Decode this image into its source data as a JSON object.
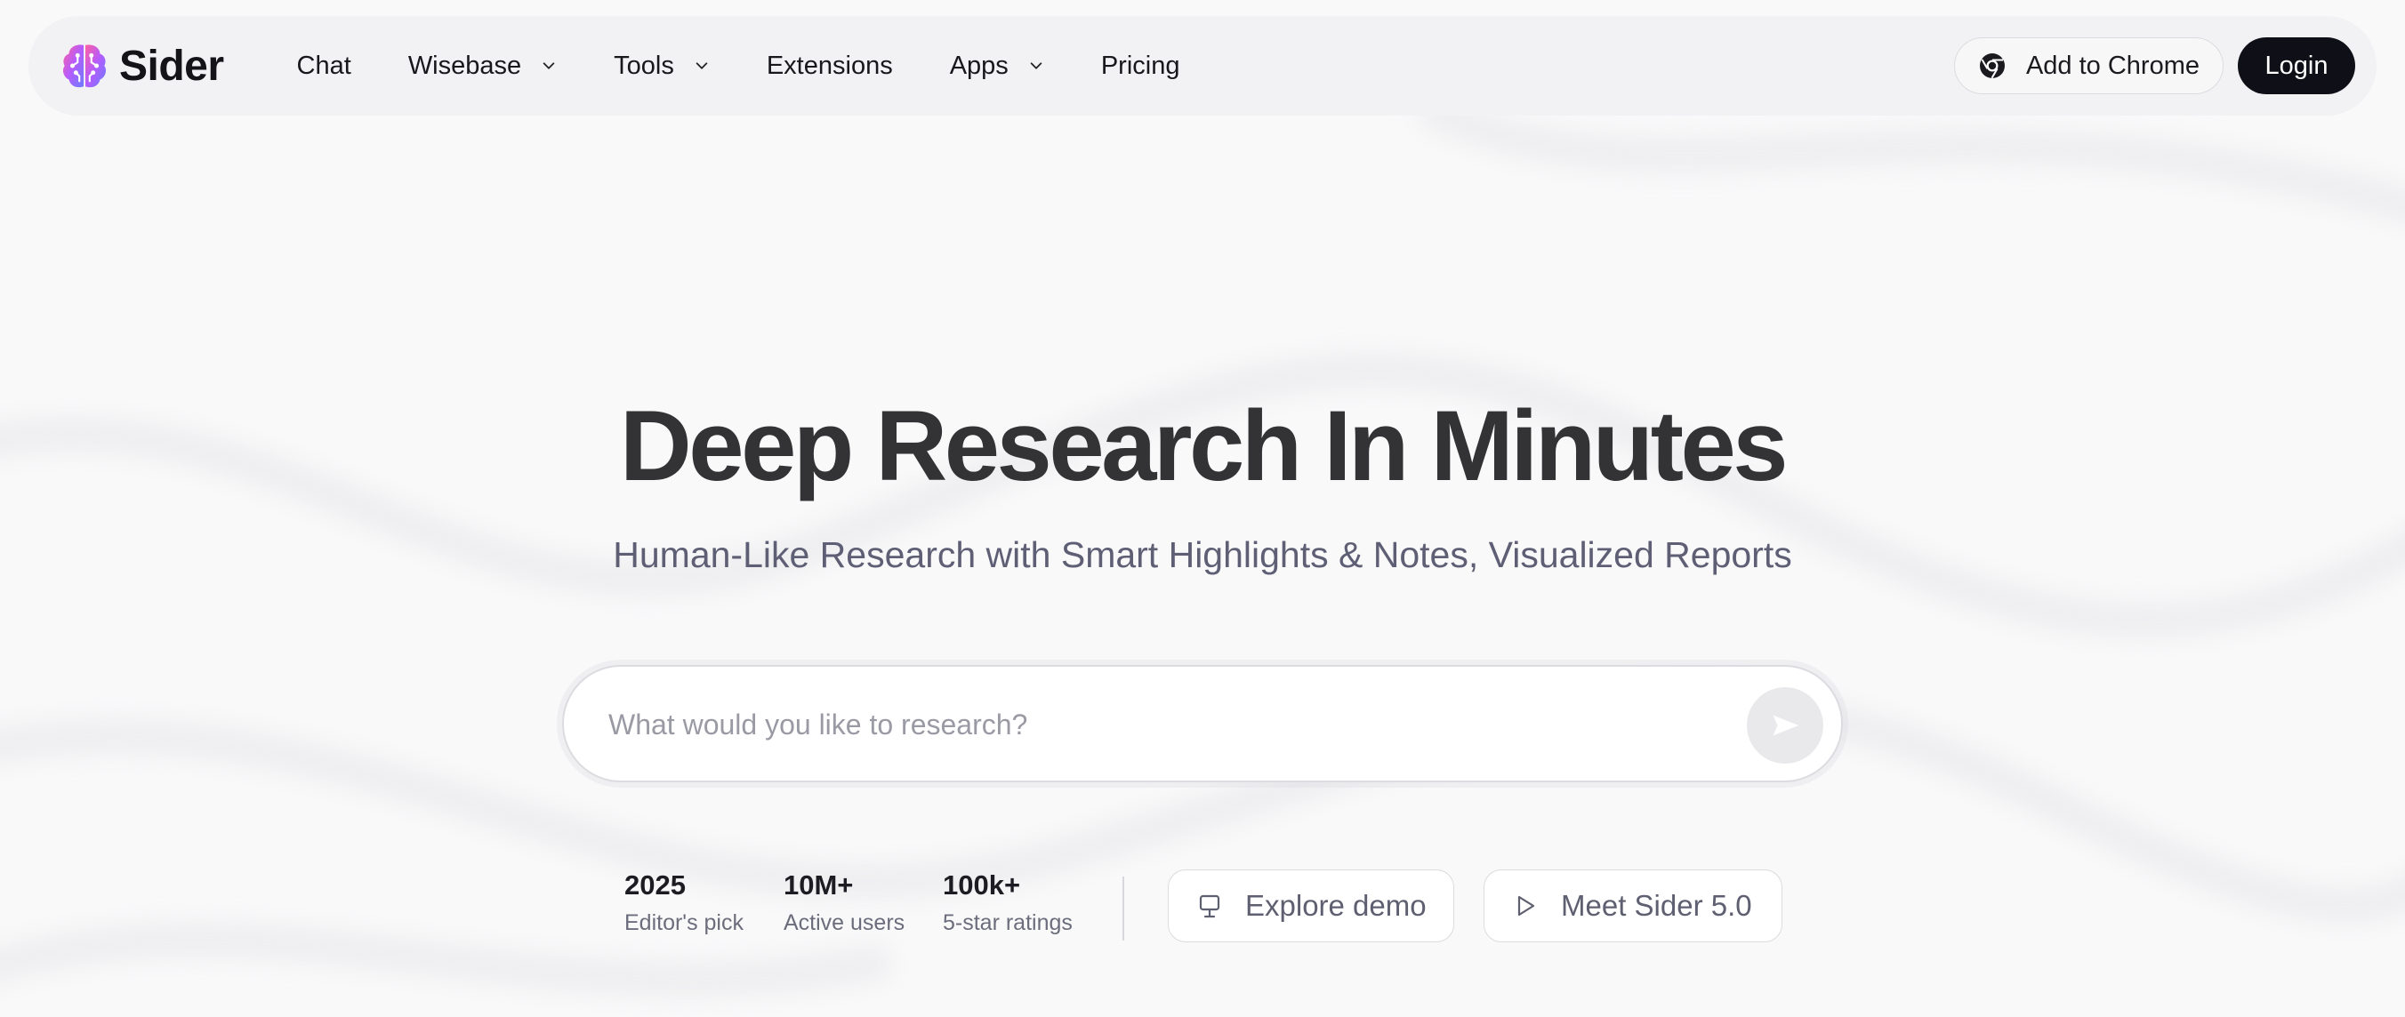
{
  "brand": {
    "name": "Sider",
    "logo_icon": "brain-icon"
  },
  "nav": {
    "items": [
      {
        "label": "Chat",
        "has_dropdown": false
      },
      {
        "label": "Wisebase",
        "has_dropdown": true
      },
      {
        "label": "Tools",
        "has_dropdown": true
      },
      {
        "label": "Extensions",
        "has_dropdown": false
      },
      {
        "label": "Apps",
        "has_dropdown": true
      },
      {
        "label": "Pricing",
        "has_dropdown": false
      }
    ],
    "add_to_chrome": "Add to Chrome",
    "login": "Login"
  },
  "hero": {
    "title": "Deep Research In Minutes",
    "subtitle": "Human-Like Research with Smart Highlights & Notes, Visualized Reports"
  },
  "search": {
    "placeholder": "What would you like to research?",
    "value": ""
  },
  "stats": [
    {
      "value": "2025",
      "label": "Editor's pick"
    },
    {
      "value": "10M+",
      "label": "Active users"
    },
    {
      "value": "100k+",
      "label": "5-star ratings"
    }
  ],
  "actions": {
    "explore_demo": "Explore demo",
    "meet_sider": "Meet Sider 5.0"
  },
  "colors": {
    "background": "#f9f9fa",
    "nav_background": "#f2f2f4",
    "login_background": "#0f0f17",
    "title": "#333336",
    "subtitle": "#5e5f75"
  }
}
